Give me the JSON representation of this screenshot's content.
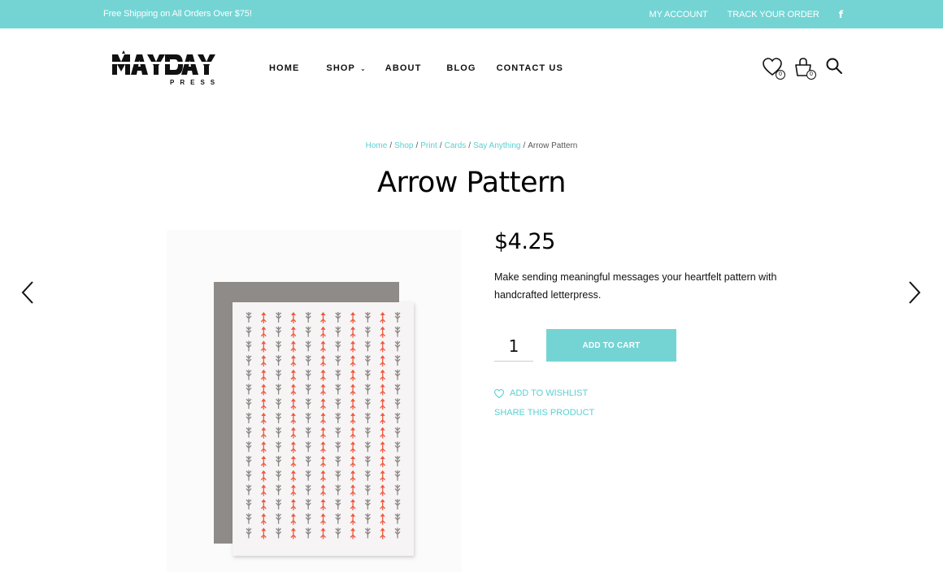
{
  "colors": {
    "accent": "#74d4d4",
    "link": "#5ccfd0"
  },
  "topbar": {
    "promo": "Free Shipping on All Orders Over $75!",
    "my_account": "MY ACCOUNT",
    "track_order": "TRACK YOUR ORDER",
    "social_icon": "facebook-icon",
    "social_glyph": "f"
  },
  "logo": {
    "line1": "MAYDAY",
    "line2": "PRESS"
  },
  "nav": {
    "items": [
      {
        "label": "HOME"
      },
      {
        "label": "SHOP",
        "has_dropdown": true
      },
      {
        "label": "ABOUT"
      },
      {
        "label": "BLOG"
      },
      {
        "label": "CONTACT US"
      }
    ]
  },
  "header_icons": {
    "wishlist_count": "0",
    "cart_count": "0"
  },
  "breadcrumb": {
    "links": [
      "Home",
      "Shop",
      "Print",
      "Cards",
      "Say Anything"
    ],
    "current": "Arrow Pattern"
  },
  "product": {
    "title": "Arrow Pattern",
    "price": "$4.25",
    "description": "Make sending meaningful messages your heartfelt pattern with handcrafted letterpress.",
    "quantity": "1",
    "add_to_cart": "ADD TO CART",
    "add_to_wishlist": "ADD TO WISHLIST",
    "share": "SHARE THIS PRODUCT"
  }
}
